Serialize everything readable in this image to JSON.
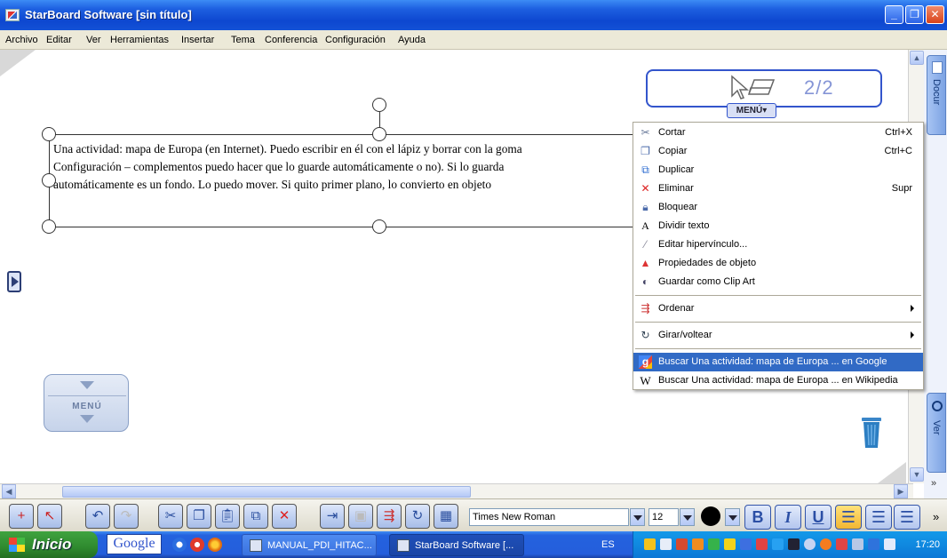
{
  "window": {
    "title": "StarBoard Software [sin título]"
  },
  "menubar": [
    "Archivo",
    "Editar",
    "Ver",
    "Herramientas",
    "Insertar",
    "Tema",
    "Conferencia",
    "Configuración",
    "Ayuda"
  ],
  "textbox": {
    "lines": [
      "Una actividad: mapa de Europa (en Internet). Puedo escribir en él con el lápiz y borrar con la goma",
      "Configuración – complementos puedo hacer que lo guarde automáticamente o no). Si lo guarda",
      "automáticamente es un fondo. Lo puedo mover. Si quito primer plano, lo convierto en objeto"
    ]
  },
  "page_widget": {
    "pager": "2/2",
    "menu_label": "MENÚ"
  },
  "left_menu": {
    "label": "MENÚ"
  },
  "side_tabs": {
    "documents": "Docur",
    "view": "Ver"
  },
  "context_menu": {
    "items": [
      {
        "label": "Cortar",
        "shortcut": "Ctrl+X",
        "icon": "scissors-icon"
      },
      {
        "label": "Copiar",
        "shortcut": "Ctrl+C",
        "icon": "copy-icon"
      },
      {
        "label": "Duplicar",
        "shortcut": "",
        "icon": "duplicate-icon"
      },
      {
        "label": "Eliminar",
        "shortcut": "Supr",
        "icon": "delete-icon"
      },
      {
        "label": "Bloquear",
        "shortcut": "",
        "icon": "lock-icon"
      },
      {
        "label": "Dividir texto",
        "shortcut": "",
        "icon": "split-text-icon"
      },
      {
        "label": "Editar hipervínculo...",
        "shortcut": "",
        "icon": "hyperlink-icon"
      },
      {
        "label": "Propiedades de objeto",
        "shortcut": "",
        "icon": "properties-icon"
      },
      {
        "label": "Guardar como Clip Art",
        "shortcut": "",
        "icon": "clipart-icon"
      }
    ],
    "ordenar": "Ordenar",
    "girar": "Girar/voltear",
    "search_google": "Buscar Una actividad: mapa de Europa ... en Google",
    "search_wikipedia": "Buscar Una actividad: mapa de Europa ... en Wikipedia"
  },
  "toolbar": {
    "font": "Times New Roman",
    "size": "12",
    "bold": "B",
    "italic": "I",
    "underline": "U",
    "more": "»"
  },
  "taskbar": {
    "start": "Inicio",
    "google": "Google",
    "tasks": [
      "MANUAL_PDI_HITAC...",
      "StarBoard Software [..."
    ],
    "lang": "ES",
    "clock": "17:20"
  },
  "colors": {
    "highlight": "#316ac5",
    "titlebar": "#0d47d0",
    "widget_border": "#3355cc"
  }
}
